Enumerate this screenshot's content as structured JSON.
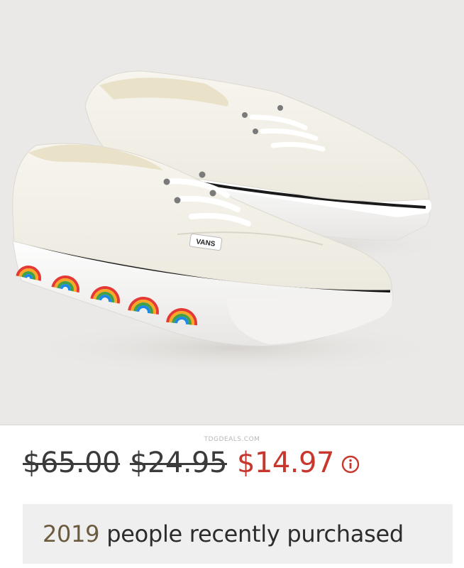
{
  "product": {
    "image_alt": "White low-top canvas sneakers with rainbow sidewall print",
    "brand_tag": "VANS"
  },
  "watermark": "TDGDEALS.COM",
  "pricing": {
    "original_price": "$65.00",
    "previous_price": "$24.95",
    "sale_price": "$14.97",
    "info_icon": "info-circle-icon"
  },
  "social_proof": {
    "count": "2019",
    "text": "people recently purchased"
  },
  "colors": {
    "background": "#ebe9e7",
    "sale_price": "#c8372d",
    "count": "#6b5a3e",
    "box": "#efefef"
  }
}
